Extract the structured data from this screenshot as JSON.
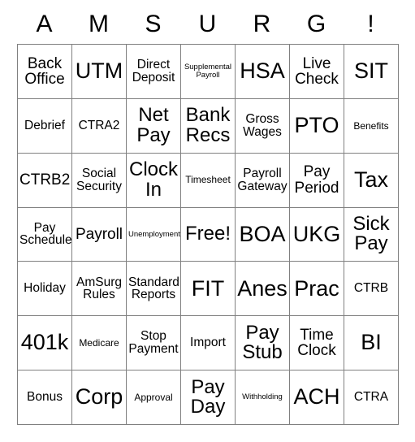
{
  "card": {
    "title_letters": [
      "A",
      "M",
      "S",
      "U",
      "R",
      "G",
      "!"
    ],
    "free_space_label": "Free!",
    "columns": 7,
    "rows": 7,
    "grid_line_color": "#808080",
    "border_color": "#4d4d4d",
    "background_color": "#ffffff",
    "text_color": "#000000",
    "cells": [
      [
        {
          "label": "Back\nOffice",
          "size": "l"
        },
        {
          "label": "UTM",
          "size": "xxl"
        },
        {
          "label": "Direct\nDeposit",
          "size": "m"
        },
        {
          "label": "Supplemental\nPayroll",
          "size": "xs"
        },
        {
          "label": "HSA",
          "size": "xxl"
        },
        {
          "label": "Live\nCheck",
          "size": "l"
        },
        {
          "label": "SIT",
          "size": "xxl"
        }
      ],
      [
        {
          "label": "Debrief",
          "size": "m"
        },
        {
          "label": "CTRA2",
          "size": "m"
        },
        {
          "label": "Net\nPay",
          "size": "xl"
        },
        {
          "label": "Bank\nRecs",
          "size": "xl"
        },
        {
          "label": "Gross\nWages",
          "size": "m"
        },
        {
          "label": "PTO",
          "size": "xxl"
        },
        {
          "label": "Benefits",
          "size": "s"
        }
      ],
      [
        {
          "label": "CTRB2",
          "size": "l"
        },
        {
          "label": "Social\nSecurity",
          "size": "m"
        },
        {
          "label": "Clock\nIn",
          "size": "xl"
        },
        {
          "label": "Timesheet",
          "size": "s"
        },
        {
          "label": "Payroll\nGateway",
          "size": "m"
        },
        {
          "label": "Pay\nPeriod",
          "size": "l"
        },
        {
          "label": "Tax",
          "size": "xxl"
        }
      ],
      [
        {
          "label": "Pay\nSchedule",
          "size": "m"
        },
        {
          "label": "Payroll",
          "size": "l"
        },
        {
          "label": "Unemployment",
          "size": "xs"
        },
        {
          "label": "Free!",
          "size": "xl"
        },
        {
          "label": "BOA",
          "size": "xxl"
        },
        {
          "label": "UKG",
          "size": "xxl"
        },
        {
          "label": "Sick\nPay",
          "size": "xl"
        }
      ],
      [
        {
          "label": "Holiday",
          "size": "m"
        },
        {
          "label": "AmSurg\nRules",
          "size": "m"
        },
        {
          "label": "Standard\nReports",
          "size": "m"
        },
        {
          "label": "FIT",
          "size": "xxl"
        },
        {
          "label": "Anes",
          "size": "xxl"
        },
        {
          "label": "Prac",
          "size": "xxl"
        },
        {
          "label": "CTRB",
          "size": "m"
        }
      ],
      [
        {
          "label": "401k",
          "size": "xxl"
        },
        {
          "label": "Medicare",
          "size": "s"
        },
        {
          "label": "Stop\nPayment",
          "size": "m"
        },
        {
          "label": "Import",
          "size": "m"
        },
        {
          "label": "Pay\nStub",
          "size": "xl"
        },
        {
          "label": "Time\nClock",
          "size": "l"
        },
        {
          "label": "BI",
          "size": "xxl"
        }
      ],
      [
        {
          "label": "Bonus",
          "size": "m"
        },
        {
          "label": "Corp",
          "size": "xxl"
        },
        {
          "label": "Approval",
          "size": "s"
        },
        {
          "label": "Pay\nDay",
          "size": "xl"
        },
        {
          "label": "Withholding",
          "size": "xs"
        },
        {
          "label": "ACH",
          "size": "xxl"
        },
        {
          "label": "CTRA",
          "size": "m"
        }
      ]
    ]
  }
}
